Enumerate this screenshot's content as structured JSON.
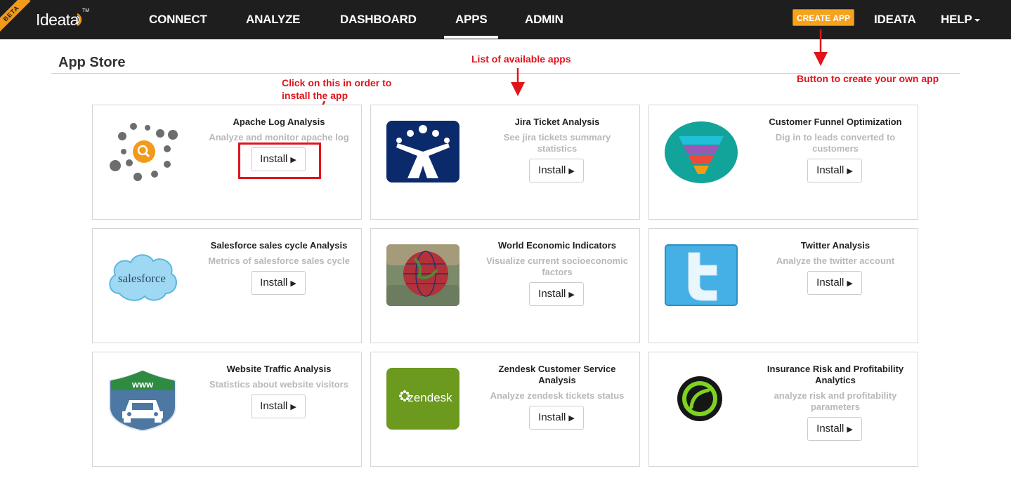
{
  "nav": {
    "beta": "BETA",
    "logo": "Ideata",
    "logo_tm": "TM",
    "items": [
      "CONNECT",
      "ANALYZE",
      "DASHBOARD",
      "APPS",
      "ADMIN"
    ],
    "create_app": "CREATE APP",
    "user": "IDEATA",
    "help": "HELP"
  },
  "page": {
    "title": "App Store"
  },
  "annotations": {
    "install_hint_line1": "Click on this in order to",
    "install_hint_line2": "install the app",
    "apps_hint": "List of available apps",
    "create_hint": "Button to create your own app"
  },
  "apps": [
    {
      "title": "Apache Log Analysis",
      "desc": "Analyze and monitor apache log",
      "button": "Install",
      "icon": "apache-log-icon"
    },
    {
      "title": "Jira Ticket Analysis",
      "desc": "See jira tickets summary statistics",
      "button": "Install",
      "icon": "jira-icon"
    },
    {
      "title": "Customer Funnel Optimization",
      "desc": "Dig in to leads converted to customers",
      "button": "Install",
      "icon": "funnel-icon"
    },
    {
      "title": "Salesforce sales cycle Analysis",
      "desc": "Metrics of salesforce sales cycle",
      "button": "Install",
      "icon": "salesforce-icon"
    },
    {
      "title": "World Economic Indicators",
      "desc": "Visualize current socioeconomic factors",
      "button": "Install",
      "icon": "globe-icon"
    },
    {
      "title": "Twitter Analysis",
      "desc": "Analyze the twitter account",
      "button": "Install",
      "icon": "twitter-icon"
    },
    {
      "title": "Website Traffic Analysis",
      "desc": "Statistics about website visitors",
      "button": "Install",
      "icon": "www-car-icon"
    },
    {
      "title": "Zendesk Customer Service Analysis",
      "desc": "Analyze zendesk tickets status",
      "button": "Install",
      "icon": "zendesk-icon"
    },
    {
      "title": "Insurance Risk and Profitability Analytics",
      "desc": "analyze risk and profitability parameters",
      "button": "Install",
      "icon": "insurance-icon"
    }
  ],
  "icon_labels": {
    "www": "www",
    "salesforce": "salesforce",
    "zendesk": "zendesk"
  },
  "colors": {
    "navbar": "#1e1e1e",
    "accent_orange": "#f6a21c",
    "annotation_red": "#e0141b"
  }
}
